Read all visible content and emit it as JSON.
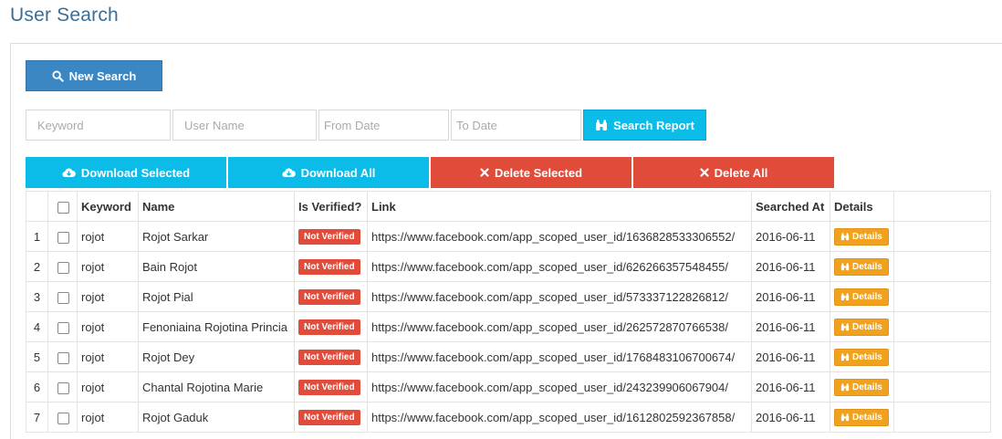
{
  "page": {
    "title": "User Search"
  },
  "toolbar": {
    "new_search_label": "New Search"
  },
  "filters": {
    "keyword_placeholder": "Keyword",
    "username_placeholder": "User Name",
    "from_placeholder": "From Date",
    "to_placeholder": "To Date",
    "search_report_label": "Search Report"
  },
  "actions": {
    "download_selected": "Download Selected",
    "download_all": "Download All",
    "delete_selected": "Delete Selected",
    "delete_all": "Delete All"
  },
  "colors": {
    "primary": "#3a87c4",
    "info": "#0bbbe8",
    "danger": "#e04b3a",
    "warning": "#f0a21e"
  },
  "table": {
    "columns": [
      "",
      "",
      "Keyword",
      "Name",
      "Is Verified?",
      "Link",
      "Searched At",
      "Details",
      ""
    ],
    "rows": [
      {
        "num": "1",
        "keyword": "rojot",
        "name": "Rojot Sarkar",
        "verified": "Not Verified",
        "link": "https://www.facebook.com/app_scoped_user_id/1636828533306552/",
        "searched_at": "2016-06-11",
        "details": "Details"
      },
      {
        "num": "2",
        "keyword": "rojot",
        "name": "Bain Rojot",
        "verified": "Not Verified",
        "link": "https://www.facebook.com/app_scoped_user_id/626266357548455/",
        "searched_at": "2016-06-11",
        "details": "Details"
      },
      {
        "num": "3",
        "keyword": "rojot",
        "name": "Rojot Pial",
        "verified": "Not Verified",
        "link": "https://www.facebook.com/app_scoped_user_id/573337122826812/",
        "searched_at": "2016-06-11",
        "details": "Details"
      },
      {
        "num": "4",
        "keyword": "rojot",
        "name": "Fenoniaina Rojotina Princia",
        "verified": "Not Verified",
        "link": "https://www.facebook.com/app_scoped_user_id/262572870766538/",
        "searched_at": "2016-06-11",
        "details": "Details"
      },
      {
        "num": "5",
        "keyword": "rojot",
        "name": "Rojot Dey",
        "verified": "Not Verified",
        "link": "https://www.facebook.com/app_scoped_user_id/1768483106700674/",
        "searched_at": "2016-06-11",
        "details": "Details"
      },
      {
        "num": "6",
        "keyword": "rojot",
        "name": "Chantal Rojotina Marie",
        "verified": "Not Verified",
        "link": "https://www.facebook.com/app_scoped_user_id/243239906067904/",
        "searched_at": "2016-06-11",
        "details": "Details"
      },
      {
        "num": "7",
        "keyword": "rojot",
        "name": "Rojot Gaduk",
        "verified": "Not Verified",
        "link": "https://www.facebook.com/app_scoped_user_id/1612802592367858/",
        "searched_at": "2016-06-11",
        "details": "Details"
      }
    ]
  }
}
